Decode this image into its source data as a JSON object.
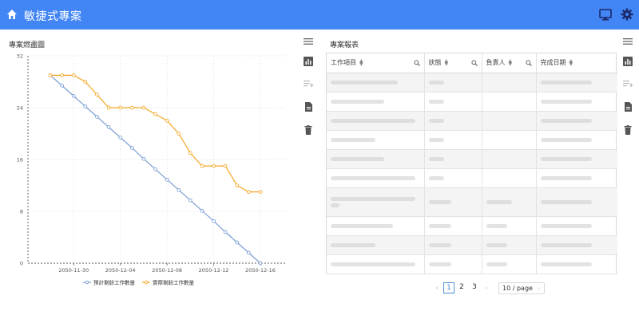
{
  "app": {
    "title": "敏捷式專案"
  },
  "left_panel": {
    "title": "專案燃盡圖"
  },
  "right_panel": {
    "title": "專案報表"
  },
  "icons": {
    "home": "home-icon",
    "monitor": "monitor-icon",
    "settings": "gear-icon",
    "menu": "menu-icon",
    "chart": "bar-chart-icon",
    "add_list": "playlist-add-icon",
    "document": "document-icon",
    "delete": "trash-icon"
  },
  "colors": {
    "topbar": "#4285f4",
    "planned": "#7b9fd4",
    "actual": "#f5a623"
  },
  "table": {
    "columns": [
      {
        "label": "工作項目",
        "sortable": true,
        "searchable": true
      },
      {
        "label": "狀態",
        "sortable": true,
        "searchable": true
      },
      {
        "label": "負責人",
        "sortable": true,
        "searchable": true
      },
      {
        "label": "完成日期",
        "sortable": true,
        "searchable": false
      }
    ],
    "rows": [
      {
        "skeleton": [
          0.75,
          0.3,
          0,
          0.7
        ]
      },
      {
        "skeleton": [
          0.6,
          0.3,
          0,
          0.7
        ]
      },
      {
        "skeleton": [
          0.95,
          0.3,
          0,
          0.7
        ]
      },
      {
        "skeleton": [
          0.5,
          0.3,
          0,
          0.7
        ]
      },
      {
        "skeleton": [
          0.6,
          0.3,
          0,
          0.7
        ]
      },
      {
        "skeleton": [
          0.95,
          0.3,
          0,
          0.7
        ]
      },
      {
        "skeleton": [
          0.95,
          0.45,
          0.55,
          0.7
        ],
        "two_line": true
      },
      {
        "skeleton": [
          0.7,
          0.45,
          0.45,
          0.7
        ]
      },
      {
        "skeleton": [
          0.5,
          0.45,
          0.45,
          0.7
        ]
      },
      {
        "skeleton": [
          0.95,
          0.45,
          0.45,
          0.7
        ]
      }
    ]
  },
  "pagination": {
    "prev": "‹",
    "next": "›",
    "pages": [
      "1",
      "2",
      "3"
    ],
    "current": "1",
    "page_size": "10 / page"
  },
  "chart_data": {
    "type": "line",
    "x": [
      "2050-11-28",
      "2050-11-29",
      "2050-11-30",
      "2050-12-01",
      "2050-12-02",
      "2050-12-03",
      "2050-12-04",
      "2050-12-05",
      "2050-12-06",
      "2050-12-07",
      "2050-12-08",
      "2050-12-09",
      "2050-12-10",
      "2050-12-11",
      "2050-12-12",
      "2050-12-13",
      "2050-12-14",
      "2050-12-15",
      "2050-12-16"
    ],
    "x_tick_labels": [
      "2050-11-30",
      "2050-12-04",
      "2050-12-08",
      "2050-12-12",
      "2050-12-16"
    ],
    "series": [
      {
        "name": "預計剩餘工作數量",
        "color": "#7b9fd4",
        "values": [
          29,
          27.4,
          25.8,
          24.2,
          22.6,
          21,
          19.4,
          17.8,
          16.1,
          14.5,
          12.9,
          11.3,
          9.7,
          8.1,
          6.5,
          4.8,
          3.2,
          1.6,
          0
        ]
      },
      {
        "name": "實際剩餘工作數量",
        "color": "#f5a623",
        "values": [
          29,
          29,
          29,
          28,
          26,
          24,
          24,
          24,
          24,
          23,
          22,
          20,
          17,
          15,
          15,
          15,
          12,
          11,
          11
        ]
      }
    ],
    "y_ticks": [
      "0",
      "8",
      "16",
      "24",
      "32"
    ],
    "ylim": [
      0,
      32
    ],
    "grid": true,
    "legend_placement": "bottom"
  }
}
